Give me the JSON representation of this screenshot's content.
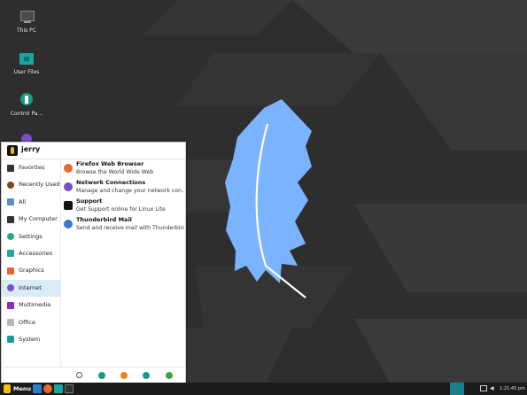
{
  "desktop": {
    "icons": [
      {
        "label": "This PC",
        "icon": "computer-icon"
      },
      {
        "label": "User Files",
        "icon": "folder-icon"
      },
      {
        "label": "Control Pa...",
        "icon": "control-panel-icon"
      }
    ]
  },
  "menu": {
    "user": "jerry",
    "categories": [
      {
        "label": "Favorites",
        "icon": "bookmark-icon",
        "color": "#333333"
      },
      {
        "label": "Recently Used",
        "icon": "clock-icon",
        "color": "#7a4a1a"
      },
      {
        "label": "All",
        "icon": "list-icon",
        "color": "#5a8fc4"
      },
      {
        "label": "My Computer",
        "icon": "computer-icon",
        "color": "#333333"
      },
      {
        "label": "Settings",
        "icon": "gear-icon",
        "color": "#27a88a"
      },
      {
        "label": "Accessories",
        "icon": "tools-icon",
        "color": "#1fa79a"
      },
      {
        "label": "Graphics",
        "icon": "graphics-icon",
        "color": "#e0663a"
      },
      {
        "label": "Internet",
        "icon": "globe-icon",
        "color": "#7b4fc9"
      },
      {
        "label": "Multimedia",
        "icon": "multimedia-icon",
        "color": "#8e2fb0"
      },
      {
        "label": "Office",
        "icon": "document-icon",
        "color": "#b8b8b8"
      },
      {
        "label": "System",
        "icon": "system-icon",
        "color": "#1f9aa0"
      }
    ],
    "selected_category": "Internet",
    "apps": [
      {
        "name": "Firefox Web Browser",
        "desc": "Browse the World Wide Web",
        "icon": "firefox-icon",
        "color": "#e86a2a"
      },
      {
        "name": "Network Connections",
        "desc": "Manage and change your network con...",
        "icon": "network-icon",
        "color": "#7b4fc9"
      },
      {
        "name": "Support",
        "desc": "Get Support online for Linux Lite",
        "icon": "linux-lite-icon",
        "color": "#111111"
      },
      {
        "name": "Thunderbird Mail",
        "desc": "Send and receive mail with Thunderbird",
        "icon": "thunderbird-icon",
        "color": "#3b78c9"
      }
    ],
    "bottom_buttons": [
      {
        "name": "search-button",
        "icon": "search-icon",
        "color": "#555555"
      },
      {
        "name": "software-button",
        "icon": "package-icon",
        "color": "#1a9a8a"
      },
      {
        "name": "lock-button",
        "icon": "lock-icon",
        "color": "#e0861a"
      },
      {
        "name": "user-button",
        "icon": "user-icon",
        "color": "#1a9a8a"
      },
      {
        "name": "logout-button",
        "icon": "power-icon",
        "color": "#37a742"
      }
    ]
  },
  "taskbar": {
    "menu_label": "Menu",
    "clock": "1:21:45 pm"
  },
  "colors": {
    "selected_bg": "#d9ecf5",
    "taskbar_bg": "#1b1b1b",
    "feather": "#7ab3ff"
  }
}
